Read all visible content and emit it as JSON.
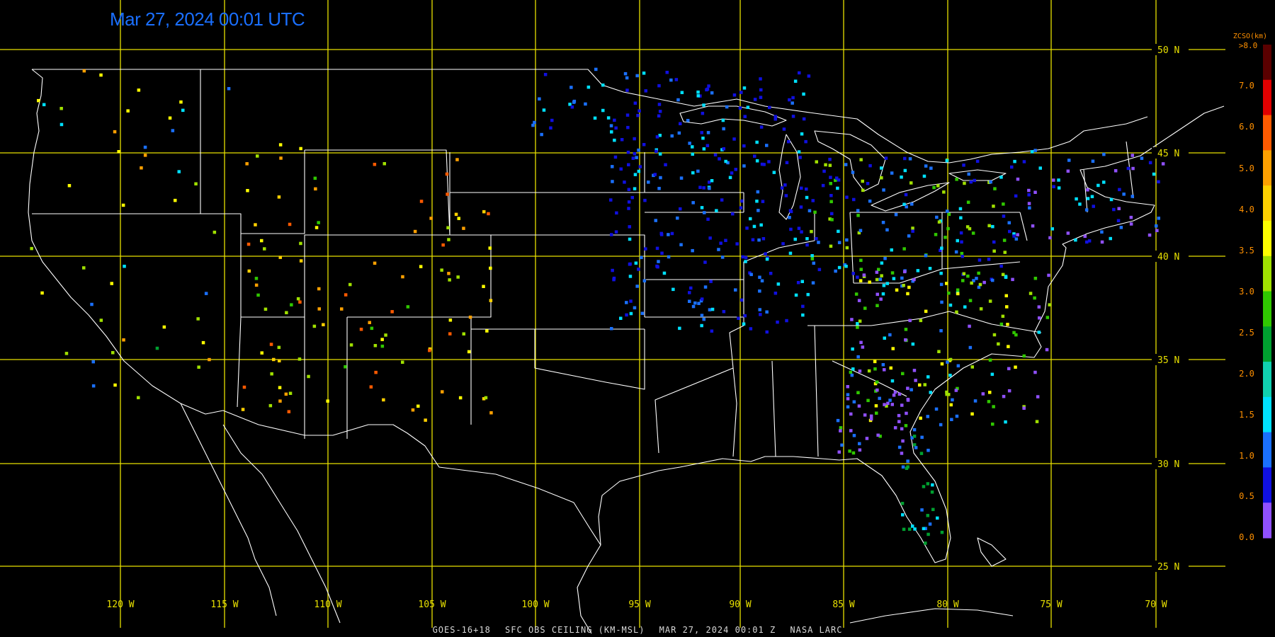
{
  "timestamp": "Mar 27, 2024 00:01 UTC",
  "footer": {
    "satellite": "GOES-16+18",
    "product": "SFC OBS CEILING (KM-MSL)",
    "datetime": "MAR 27, 2024 00:01 Z",
    "source": "NASA LARC"
  },
  "lat_labels": [
    "50 N",
    "45 N",
    "40 N",
    "35 N",
    "30 N",
    "25 N"
  ],
  "lon_labels": [
    "120 W",
    "115 W",
    "110 W",
    "105 W",
    "100 W",
    "95 W",
    "90 W",
    "85 W",
    "80 W",
    "75 W",
    "70 W"
  ],
  "legend": {
    "title": "ZCSO(km)",
    "top_label": ">8.0",
    "tick_labels": [
      "7.0",
      "6.0",
      "5.0",
      "4.0",
      "3.5",
      "3.0",
      "2.5",
      "2.0",
      "1.5",
      "1.0",
      "0.5",
      "0.0"
    ],
    "colors": [
      "#5a0000",
      "#e00000",
      "#ff5a00",
      "#ffa000",
      "#ffd000",
      "#ffff00",
      "#a0e000",
      "#30c800",
      "#00a030",
      "#10d0b0",
      "#00e0ff",
      "#1a70ff",
      "#1010e0",
      "#9050ff"
    ]
  },
  "colors": {
    "grid": "#e8e000",
    "border": "#ffffff",
    "timestamp": "#1a6fff",
    "legend_text": "#ff9000"
  }
}
